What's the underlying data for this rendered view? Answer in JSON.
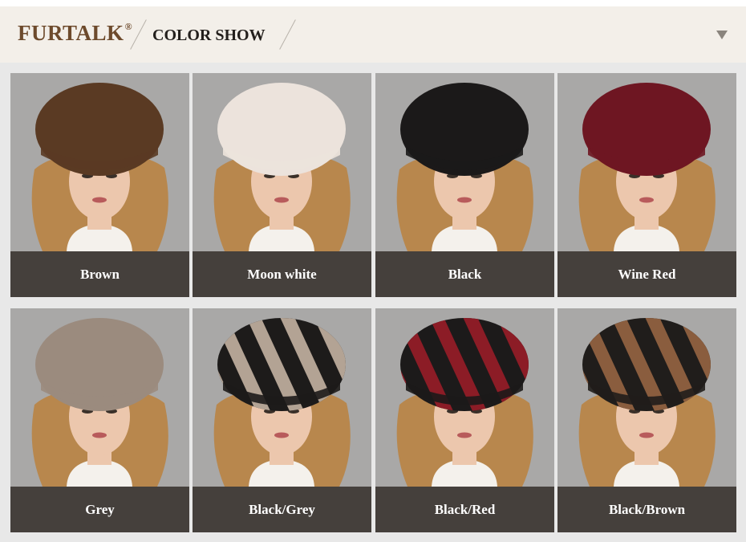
{
  "header": {
    "brand": "FURTALK",
    "brand_mark": "®",
    "section_title": "COLOR SHOW",
    "menu_icon": "triangle-down-icon"
  },
  "products": [
    {
      "name": "Brown",
      "hat": "#5a3a23",
      "stripe": null
    },
    {
      "name": "Moon white",
      "hat": "#ece3dc",
      "stripe": null
    },
    {
      "name": "Black",
      "hat": "#1b1919",
      "stripe": null
    },
    {
      "name": "Wine Red",
      "hat": "#6e1622",
      "stripe": null
    },
    {
      "name": "Grey",
      "hat": "#9b8b7e",
      "stripe": null
    },
    {
      "name": "Black/Grey",
      "hat": "#1d1b1a",
      "stripe": "#b3a394"
    },
    {
      "name": "Black/Red",
      "hat": "#1c1a1a",
      "stripe": "#8c1c26"
    },
    {
      "name": "Black/Brown",
      "hat": "#201d1b",
      "stripe": "#8a5d3e"
    }
  ],
  "colors": {
    "header_bg": "#f3efe9",
    "brand": "#6d4a2c",
    "label_bg": "#45403c",
    "photo_bg": "#a9a8a7",
    "hair": "#b8874d",
    "skin": "#ecc7ad"
  }
}
